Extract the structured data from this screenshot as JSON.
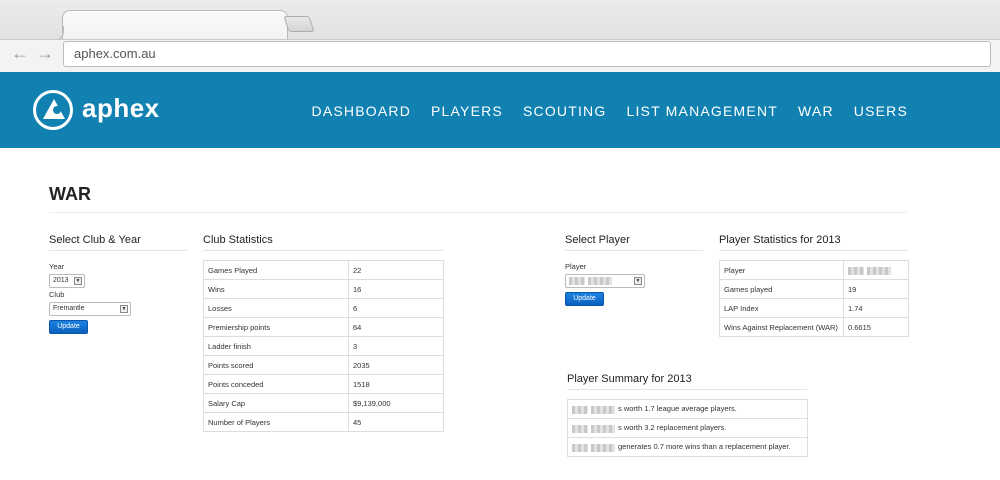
{
  "browser": {
    "url": "aphex.com.au",
    "back_icon": "arrow-left-icon",
    "forward_icon": "arrow-right-icon"
  },
  "header": {
    "brand": "aphex",
    "nav": [
      "DASHBOARD",
      "PLAYERS",
      "SCOUTING",
      "LIST MANAGEMENT",
      "WAR",
      "USERS"
    ]
  },
  "page": {
    "title": "WAR"
  },
  "club_select": {
    "title": "Select Club & Year",
    "year_label": "Year",
    "year_value": "2013",
    "club_label": "Club",
    "club_value": "Fremantle",
    "update_label": "Update"
  },
  "club_stats": {
    "title": "Club Statistics",
    "rows": [
      [
        "Games Played",
        "22"
      ],
      [
        "Wins",
        "16"
      ],
      [
        "Losses",
        "6"
      ],
      [
        "Premiership points",
        "64"
      ],
      [
        "Ladder finish",
        "3"
      ],
      [
        "Points scored",
        "2035"
      ],
      [
        "Points conceded",
        "1518"
      ],
      [
        "Salary Cap",
        "$9,139,000"
      ],
      [
        "Number of Players",
        "45"
      ]
    ]
  },
  "player_select": {
    "title": "Select Player",
    "player_label": "Player",
    "update_label": "Update"
  },
  "player_stats": {
    "title": "Player Statistics for 2013",
    "rows": [
      [
        "Player",
        ""
      ],
      [
        "Games played",
        "19"
      ],
      [
        "LAP Index",
        "1.74"
      ],
      [
        "Wins Against Replacement (WAR)",
        "0.6615"
      ]
    ]
  },
  "player_summary": {
    "title": "Player Summary for 2013",
    "rows": [
      "s worth 1.7 league average players.",
      "s worth 3.2 replacement players.",
      "generates 0.7 more wins than a replacement player."
    ]
  },
  "colors": {
    "header_bg": "#1181b2",
    "button_bg": "#0b6fd0"
  }
}
